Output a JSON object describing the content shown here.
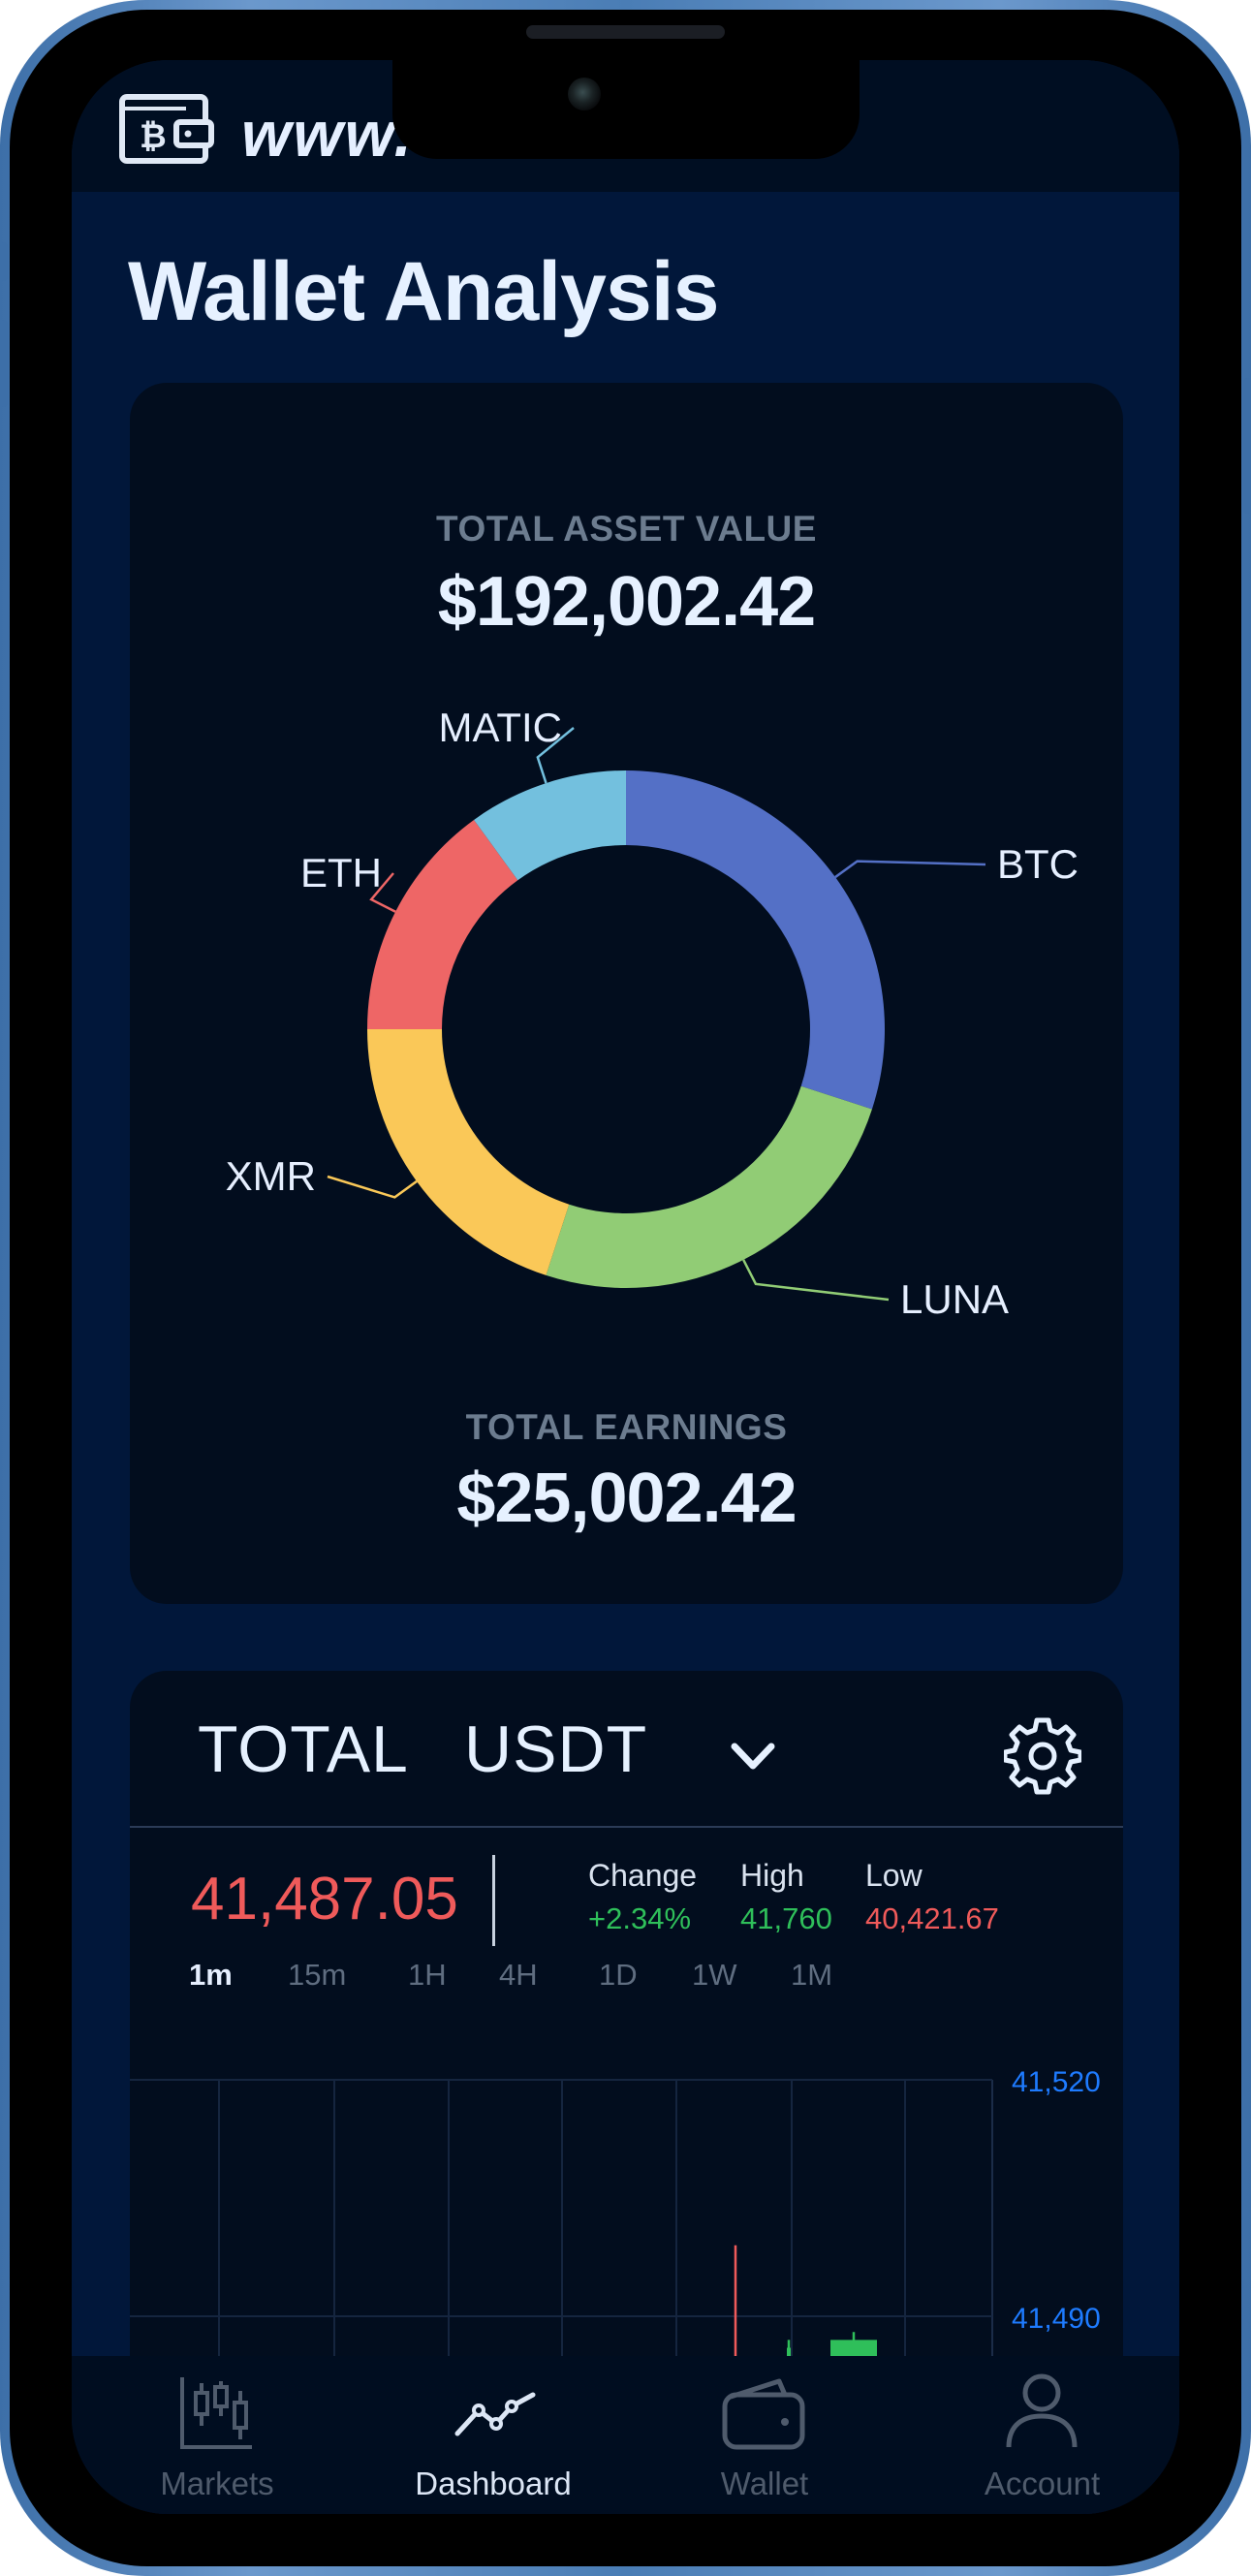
{
  "app": {
    "brand_text": "www."
  },
  "page": {
    "title": "Wallet Analysis"
  },
  "overview": {
    "total_asset_label": "TOTAL ASSET VALUE",
    "total_asset_value": "$192,002.42",
    "total_earnings_label": "TOTAL EARNINGS",
    "total_earnings_value": "$25,002.42"
  },
  "chart_data": [
    {
      "type": "pie",
      "title": "",
      "categories": [
        "BTC",
        "LUNA",
        "XMR",
        "ETH",
        "MATIC"
      ],
      "values": [
        30,
        25,
        20,
        15,
        10
      ],
      "colors": [
        "#5470c6",
        "#91cc75",
        "#fac858",
        "#ee6666",
        "#73c0de"
      ]
    },
    {
      "type": "bar",
      "title": "",
      "ylim": [
        41480,
        41530
      ],
      "yticks": [
        41520,
        41490
      ],
      "ytick_labels": [
        "41,520",
        "41,490"
      ],
      "candles": [
        {
          "color": "red",
          "high": 41499,
          "low": 41470,
          "open": 41480,
          "close": 41475
        },
        {
          "color": "green",
          "high": 41487,
          "low": 41470,
          "open": 41470,
          "close": 41486
        },
        {
          "color": "green",
          "high": 41488,
          "low": 41470,
          "open": 41475,
          "close": 41487
        }
      ],
      "grid": true
    }
  ],
  "ticker": {
    "title": "TOTAL",
    "pair": "USDT",
    "price": "41,487.05",
    "change_label": "Change",
    "change_value": "+2.34%",
    "high_label": "High",
    "high_value": "41,760",
    "low_label": "Low",
    "low_value": "40,421.67",
    "timeframes": [
      "1m",
      "15m",
      "1H",
      "4H",
      "1D",
      "1W",
      "1M"
    ],
    "active_timeframe": "1m"
  },
  "tabbar": {
    "items": [
      {
        "label": "Markets",
        "icon": "candlestick-icon"
      },
      {
        "label": "Dashboard",
        "icon": "line-chart-icon"
      },
      {
        "label": "Wallet",
        "icon": "wallet-icon"
      },
      {
        "label": "Account",
        "icon": "user-icon"
      }
    ],
    "active": "Dashboard"
  },
  "colors": {
    "screen_bg": "#01173a",
    "card_bg": "#020d1e",
    "accent_blue": "#1e7bff",
    "up": "#2fbf5a",
    "down": "#ef5a5a"
  }
}
